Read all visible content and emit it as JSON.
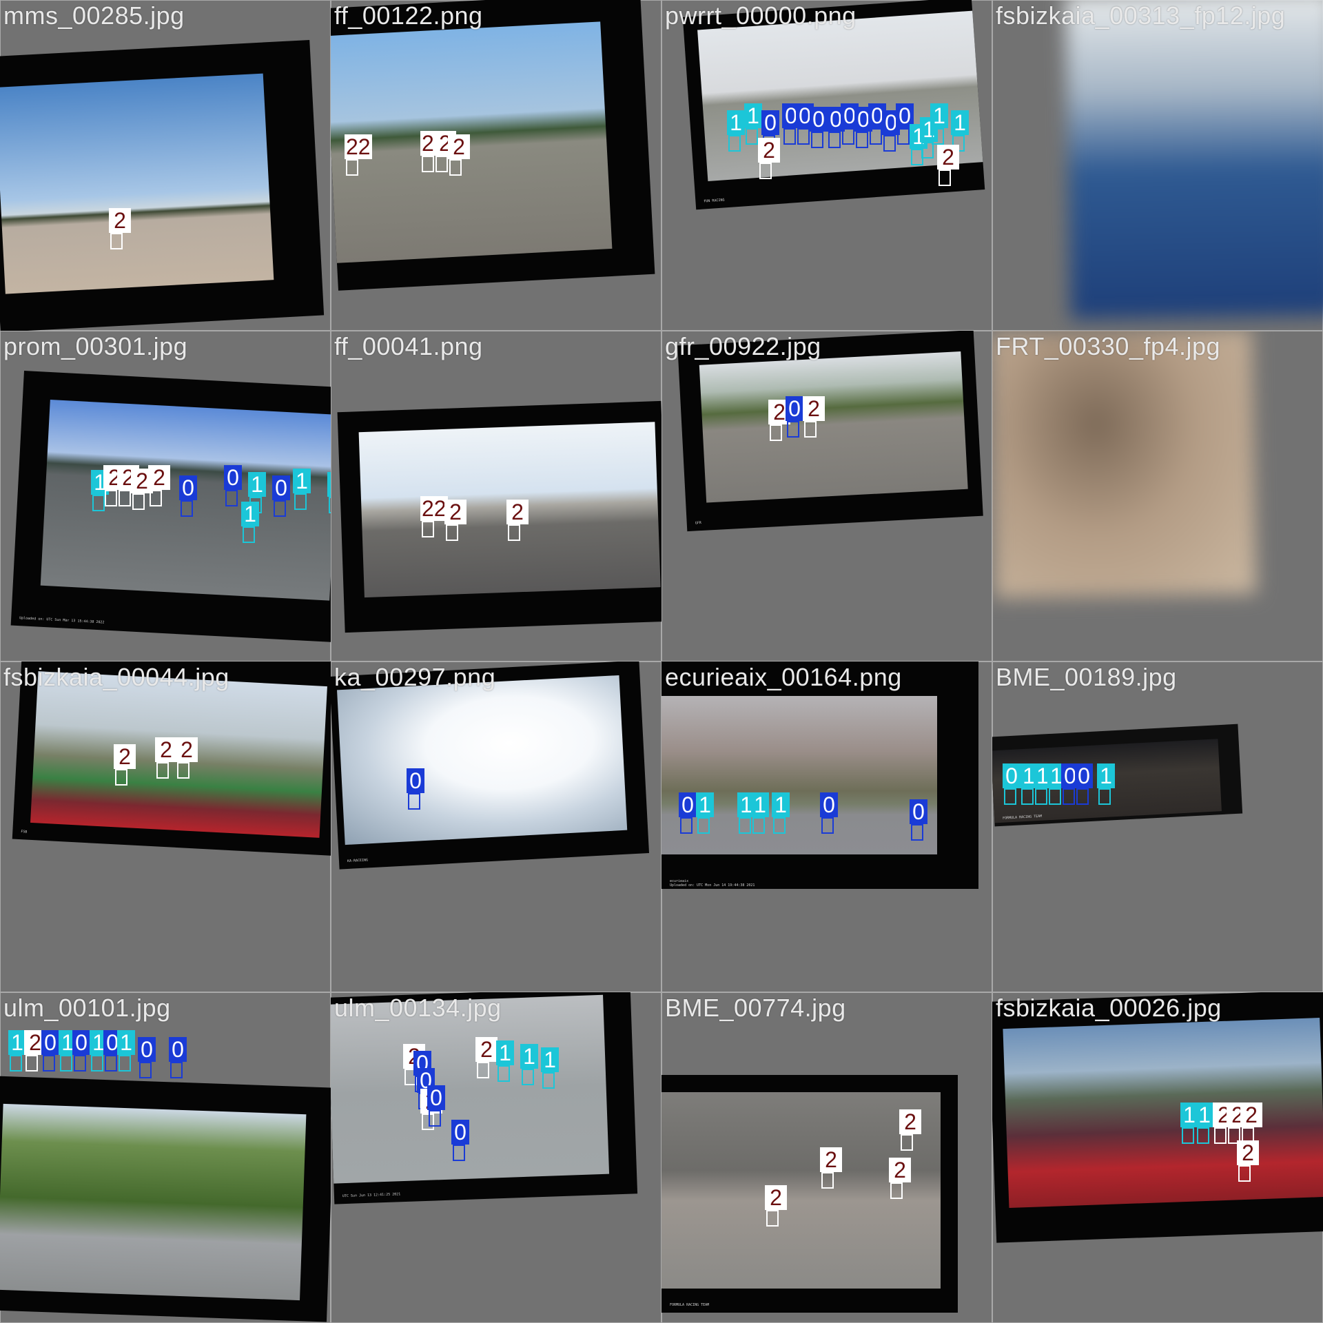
{
  "tiles": [
    {
      "filename": "mms_00285.jpg",
      "labels": [
        {
          "cls": 2,
          "text": "2"
        }
      ]
    },
    {
      "filename": "ff_00122.png",
      "labels": [
        {
          "cls": 2,
          "text": "22"
        },
        {
          "cls": 2,
          "text": "22"
        },
        {
          "cls": 2,
          "text": "2"
        },
        {
          "cls": 2,
          "text": "2"
        }
      ]
    },
    {
      "filename": "pwrrt_00000.png",
      "labels": [
        {
          "cls": 1,
          "text": "1"
        },
        {
          "cls": 1,
          "text": "1"
        },
        {
          "cls": 0,
          "text": "0"
        },
        {
          "cls": 0,
          "text": "0"
        },
        {
          "cls": 0,
          "text": "0"
        },
        {
          "cls": 0,
          "text": "0"
        },
        {
          "cls": 0,
          "text": "0"
        },
        {
          "cls": 0,
          "text": "0"
        },
        {
          "cls": 0,
          "text": "0"
        },
        {
          "cls": 0,
          "text": "0"
        },
        {
          "cls": 0,
          "text": "0"
        },
        {
          "cls": 0,
          "text": "0"
        },
        {
          "cls": 1,
          "text": "1"
        },
        {
          "cls": 1,
          "text": "1"
        },
        {
          "cls": 1,
          "text": "1"
        },
        {
          "cls": 1,
          "text": "1"
        },
        {
          "cls": 2,
          "text": "2"
        },
        {
          "cls": 2,
          "text": "2"
        }
      ],
      "watermark": "FUN RACING"
    },
    {
      "filename": "fsbizkaia_00313_fp12.jpg",
      "labels": []
    },
    {
      "filename": "prom_00301.jpg",
      "labels": [
        {
          "cls": 1,
          "text": "1"
        },
        {
          "cls": 2,
          "text": "2"
        },
        {
          "cls": 2,
          "text": "2"
        },
        {
          "cls": 2,
          "text": "2"
        },
        {
          "cls": 2,
          "text": "2"
        },
        {
          "cls": 0,
          "text": "0"
        },
        {
          "cls": 0,
          "text": "0"
        },
        {
          "cls": 1,
          "text": "1"
        },
        {
          "cls": 0,
          "text": "0"
        },
        {
          "cls": 1,
          "text": "1"
        },
        {
          "cls": 1,
          "text": "1"
        },
        {
          "cls": 1,
          "text": "1"
        }
      ],
      "watermark": "Uploaded on: UTC Sun Mar 13 15:44:38 2022"
    },
    {
      "filename": "ff_00041.png",
      "labels": [
        {
          "cls": 2,
          "text": "22"
        },
        {
          "cls": 2,
          "text": "2"
        },
        {
          "cls": 2,
          "text": "2"
        }
      ]
    },
    {
      "filename": "gfr_00922.jpg",
      "labels": [
        {
          "cls": 2,
          "text": "2"
        },
        {
          "cls": 0,
          "text": "0"
        },
        {
          "cls": 2,
          "text": "2"
        }
      ],
      "watermark": "GFR"
    },
    {
      "filename": "FRT_00330_fp4.jpg",
      "labels": []
    },
    {
      "filename": "fsbizkaia_00044.jpg",
      "labels": [
        {
          "cls": 2,
          "text": "2"
        },
        {
          "cls": 2,
          "text": "2"
        },
        {
          "cls": 2,
          "text": "2"
        }
      ],
      "watermark": "FSB"
    },
    {
      "filename": "ka_00297.png",
      "labels": [
        {
          "cls": 0,
          "text": "0"
        }
      ],
      "watermark": "KA-RACEING"
    },
    {
      "filename": "ecurieaix_00164.png",
      "labels": [
        {
          "cls": 0,
          "text": "0"
        },
        {
          "cls": 1,
          "text": "1"
        },
        {
          "cls": 1,
          "text": "1"
        },
        {
          "cls": 1,
          "text": "1"
        },
        {
          "cls": 1,
          "text": "1"
        },
        {
          "cls": 0,
          "text": "0"
        },
        {
          "cls": 0,
          "text": "0"
        }
      ],
      "watermark": "ecurieaix",
      "upload_text": "Uploaded on: UTC Mon Jun 14 19:44:38 2021"
    },
    {
      "filename": "BME_00189.jpg",
      "labels": [
        {
          "cls": 1,
          "text": "0"
        },
        {
          "cls": 1,
          "text": "1"
        },
        {
          "cls": 1,
          "text": "1"
        },
        {
          "cls": 1,
          "text": "1"
        },
        {
          "cls": 0,
          "text": "0"
        },
        {
          "cls": 0,
          "text": "0"
        },
        {
          "cls": 1,
          "text": "1"
        }
      ],
      "watermark": "FORMULA RACING TEAM"
    },
    {
      "filename": "ulm_00101.jpg",
      "labels": [
        {
          "cls": 1,
          "text": "1"
        },
        {
          "cls": 2,
          "text": "2"
        },
        {
          "cls": 0,
          "text": "0"
        },
        {
          "cls": 1,
          "text": "1"
        },
        {
          "cls": 0,
          "text": "0"
        },
        {
          "cls": 1,
          "text": "1"
        },
        {
          "cls": 0,
          "text": "0"
        },
        {
          "cls": 1,
          "text": "1"
        },
        {
          "cls": 0,
          "text": "0"
        },
        {
          "cls": 0,
          "text": "0"
        }
      ]
    },
    {
      "filename": "ulm_00134.jpg",
      "labels": [
        {
          "cls": 2,
          "text": "2"
        },
        {
          "cls": 0,
          "text": "0"
        },
        {
          "cls": 0,
          "text": "0"
        },
        {
          "cls": 2,
          "text": "2"
        },
        {
          "cls": 0,
          "text": "0"
        },
        {
          "cls": 0,
          "text": "0"
        },
        {
          "cls": 2,
          "text": "2"
        },
        {
          "cls": 1,
          "text": "1"
        },
        {
          "cls": 1,
          "text": "1"
        },
        {
          "cls": 1,
          "text": "1"
        }
      ],
      "watermark": "UTC Sun Jun 13 12:41:25 2021"
    },
    {
      "filename": "BME_00774.jpg",
      "labels": [
        {
          "cls": 2,
          "text": "2"
        },
        {
          "cls": 2,
          "text": "2"
        },
        {
          "cls": 2,
          "text": "2"
        },
        {
          "cls": 2,
          "text": "2"
        }
      ],
      "watermark": "FORMULA RACING TEAM"
    },
    {
      "filename": "fsbizkaia_00026.jpg",
      "labels": [
        {
          "cls": 1,
          "text": "1"
        },
        {
          "cls": 1,
          "text": "1"
        },
        {
          "cls": 2,
          "text": "2"
        },
        {
          "cls": 2,
          "text": "2"
        },
        {
          "cls": 2,
          "text": "2"
        },
        {
          "cls": 2,
          "text": "2"
        }
      ]
    }
  ],
  "class_colors": {
    "0": "#1a3bd6",
    "1": "#1cc6d8",
    "2": "#ffffff"
  },
  "label_text_colors": {
    "0": "#ffffff",
    "1": "#ffffff",
    "2": "#6b1010"
  },
  "tile_background": "#727272"
}
